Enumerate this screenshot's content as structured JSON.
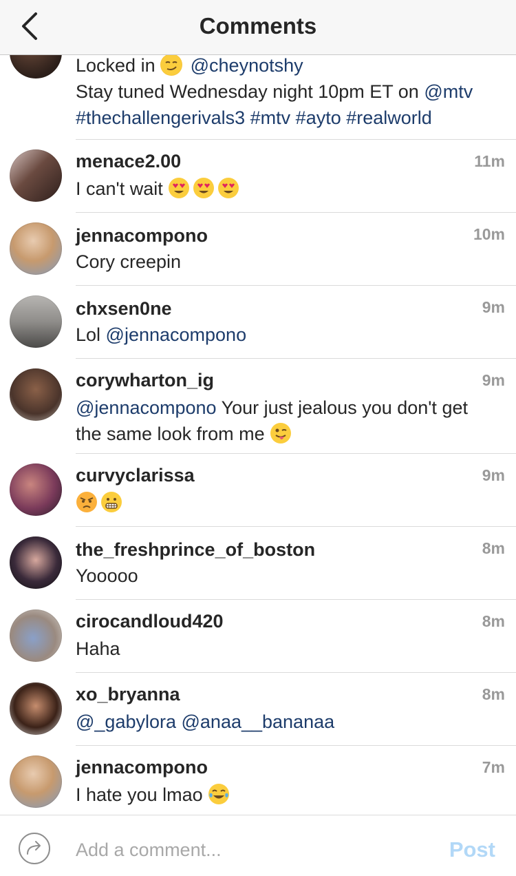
{
  "header": {
    "title": "Comments",
    "back_icon": "chevron-left-icon"
  },
  "caption": {
    "line1": "Locked in",
    "emoji1": "smirk-emoji",
    "mention": "@cheynotshy",
    "line2_prefix": "Stay tuned Wednesday night 10pm ET on",
    "line2_mention": "@mtv",
    "hashtags": "#thechallengerivals3 #mtv #ayto #realworld"
  },
  "comments": [
    {
      "username": "menace2.00",
      "time": "11m",
      "text": "I can't wait",
      "emojis": [
        "heart-eyes-emoji",
        "heart-eyes-emoji",
        "heart-eyes-emoji"
      ]
    },
    {
      "username": "jennacompono",
      "time": "10m",
      "text": "Cory creepin"
    },
    {
      "username": "chxsen0ne",
      "time": "9m",
      "text": "Lol",
      "mention": "@jennacompono"
    },
    {
      "username": "corywharton_ig",
      "time": "9m",
      "mention": "@jennacompono",
      "text": "Your just jealous you don't get",
      "text2": "the same look from me",
      "emojis": [
        "winking-tongue-emoji"
      ]
    },
    {
      "username": "curvyclarissa",
      "time": "9m",
      "emojis": [
        "angry-emoji",
        "grimacing-emoji"
      ]
    },
    {
      "username": "the_freshprince_of_boston",
      "time": "8m",
      "text": "Yooooo"
    },
    {
      "username": "cirocandloud420",
      "time": "8m",
      "text": "Haha"
    },
    {
      "username": "xo_bryanna",
      "time": "8m",
      "mention": "@_gabylora @anaa__bananaa"
    },
    {
      "username": "jennacompono",
      "time": "7m",
      "text": "I hate you lmao",
      "emojis": [
        "tears-of-joy-emoji"
      ]
    }
  ],
  "composer": {
    "placeholder": "Add a comment...",
    "post_label": "Post",
    "reply_icon": "reply-arrow-icon"
  },
  "colors": {
    "mention": "#1d3c6b",
    "post_disabled": "#b2d8f7",
    "timestamp": "#999999"
  }
}
